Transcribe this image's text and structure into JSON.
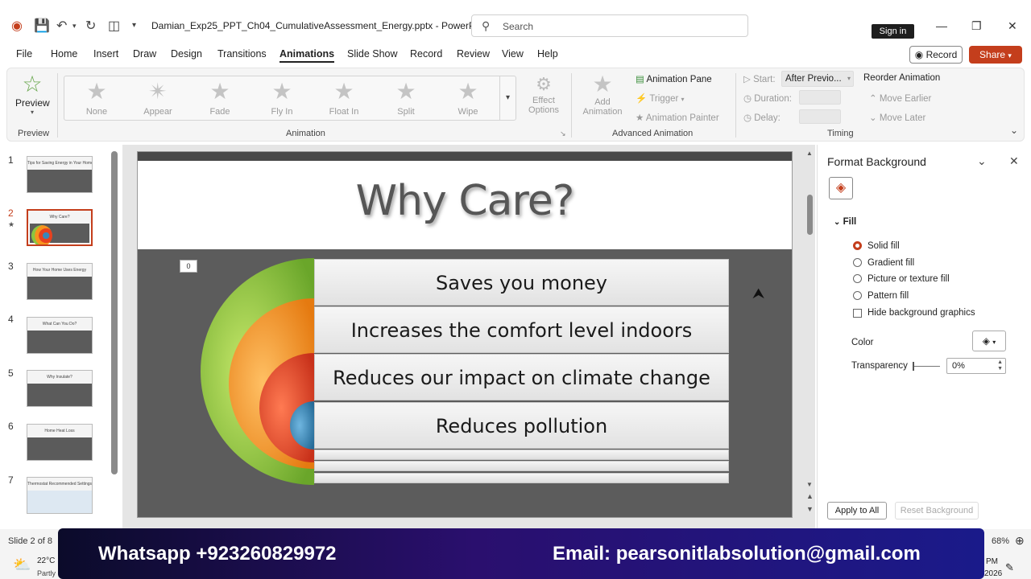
{
  "titlebar": {
    "doc_title": "Damian_Exp25_PPT_Ch04_CumulativeAssessment_Energy.pptx  -  PowerP...",
    "search_placeholder": "Search",
    "sign_in": "Sign in"
  },
  "menu": {
    "items": [
      "File",
      "Home",
      "Insert",
      "Draw",
      "Design",
      "Transitions",
      "Animations",
      "Slide Show",
      "Record",
      "Review",
      "View",
      "Help"
    ],
    "active": "Animations",
    "record": "Record",
    "share": "Share"
  },
  "ribbon": {
    "preview_label": "Preview",
    "preview_group": "Preview",
    "animations": [
      "None",
      "Appear",
      "Fade",
      "Fly In",
      "Float In",
      "Split",
      "Wipe"
    ],
    "effect_options": [
      "Effect",
      "Options"
    ],
    "animation_group": "Animation",
    "add_animation": [
      "Add",
      "Animation"
    ],
    "animation_pane": "Animation Pane",
    "trigger": "Trigger",
    "animation_painter": "Animation Painter",
    "advanced_group": "Advanced Animation",
    "start_label": "Start:",
    "start_value": "After Previo...",
    "duration_label": "Duration:",
    "delay_label": "Delay:",
    "timing_group": "Timing",
    "reorder_title": "Reorder Animation",
    "move_earlier": "Move Earlier",
    "move_later": "Move Later"
  },
  "thumbnails": [
    {
      "num": "1",
      "title": "Tips for Saving Energy in Your Home"
    },
    {
      "num": "2",
      "title": "Why Care?"
    },
    {
      "num": "3",
      "title": "How Your Home Uses Energy"
    },
    {
      "num": "4",
      "title": "What Can You Do?"
    },
    {
      "num": "5",
      "title": "Why Insulate?"
    },
    {
      "num": "6",
      "title": "Home Heat Loss"
    },
    {
      "num": "7",
      "title": "Thermostat Recommended Settings"
    }
  ],
  "slide": {
    "title": "Why Care?",
    "anim_tag": "0",
    "bullets": [
      "Saves you money",
      "Increases the comfort level indoors",
      "Reduces our impact on climate change",
      "Reduces pollution"
    ]
  },
  "format_panel": {
    "title": "Format Background",
    "fill_section": "Fill",
    "options": [
      "Solid fill",
      "Gradient fill",
      "Picture or texture fill",
      "Pattern fill"
    ],
    "selected": "Solid fill",
    "hide_graphics": "Hide background graphics",
    "color_label": "Color",
    "transparency_label": "Transparency",
    "transparency_value": "0%",
    "apply_all": "Apply to All",
    "reset": "Reset Background"
  },
  "status": {
    "slide_info": "Slide 2 of 8",
    "zoom": "68%",
    "weather_temp": "22°C",
    "weather_desc": "Partly",
    "clock_time": "PM",
    "clock_date": "2026"
  },
  "banner": {
    "whatsapp": "Whatsapp +923260829972",
    "email": "Email: pearsonitlabsolution@gmail.com"
  },
  "colors": {
    "accent": "#c43e1c",
    "slide_bg": "#5c5c5c",
    "arc_green": "#8cc63f",
    "arc_orange": "#f7941d",
    "arc_red": "#e8411f",
    "arc_blue": "#3b86b8"
  }
}
